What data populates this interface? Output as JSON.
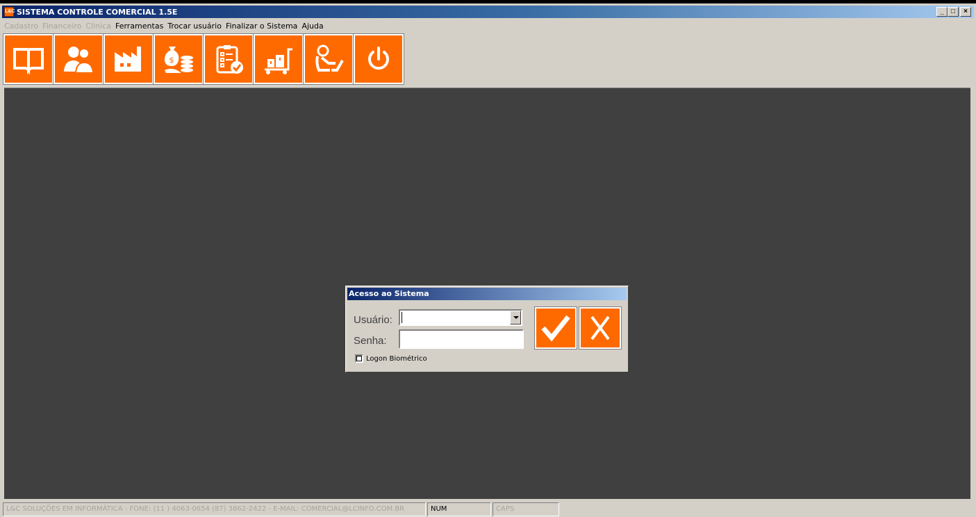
{
  "window": {
    "title": "SISTEMA CONTROLE COMERCIAL 1.5E",
    "app_icon_text": "L&C",
    "controls": {
      "minimize": "_",
      "restore": "□",
      "close": "×"
    }
  },
  "menu": {
    "items": [
      {
        "label": "Cadastro",
        "enabled": false
      },
      {
        "label": "Financeiro",
        "enabled": false
      },
      {
        "label": "Clinica",
        "enabled": false
      },
      {
        "label": "Ferramentas",
        "enabled": true
      },
      {
        "label": "Trocar usuário",
        "enabled": true
      },
      {
        "label": "Finalizar o Sistema",
        "enabled": true
      },
      {
        "label": "Ajuda",
        "enabled": true
      }
    ]
  },
  "toolbar": {
    "buttons": [
      {
        "icon": "book-icon"
      },
      {
        "icon": "people-icon"
      },
      {
        "icon": "factory-icon"
      },
      {
        "icon": "money-icon"
      },
      {
        "icon": "checklist-icon"
      },
      {
        "icon": "cart-icon"
      },
      {
        "icon": "user-computer-icon"
      },
      {
        "icon": "power-icon"
      }
    ]
  },
  "dialog": {
    "title": "Acesso ao Sistema",
    "user_label": "Usuário:",
    "user_value": "",
    "password_label": "Senha:",
    "password_value": "",
    "biometric_label": "Logon Biométrico",
    "biometric_checked": false
  },
  "statusbar": {
    "info": "L&C SOLUÇÕES EM INFORMÁTICA - FONE: (11 ) 4063-0654  (87) 3862-2422 - E-MAIL: COMERCIAL@LCINFO.COM.BR",
    "num": "NUM",
    "caps": "CAPS"
  },
  "colors": {
    "accent": "#ff6a00",
    "workspace": "#404040",
    "chrome": "#d4d0c8"
  }
}
